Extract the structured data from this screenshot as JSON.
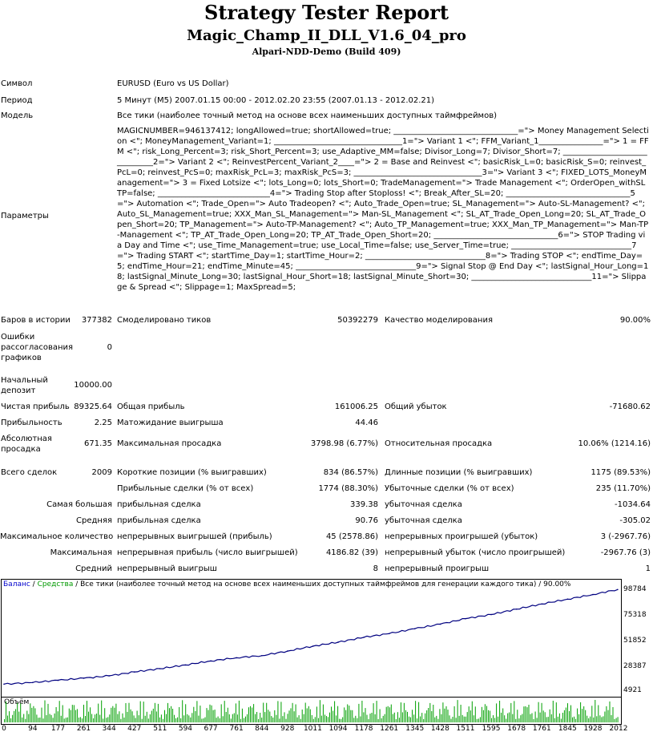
{
  "header": {
    "title": "Strategy Tester Report",
    "expert": "Magic_Champ_II_DLL_V1.6_04_pro",
    "server": "Alpari-NDD-Demo (Build 409)"
  },
  "info": {
    "symbol_label": "Символ",
    "symbol_value": "EURUSD (Euro vs US Dollar)",
    "period_label": "Период",
    "period_value": "5 Минут (M5) 2007.01.15 00:00 - 2012.02.20 23:55 (2007.01.13 - 2012.02.21)",
    "model_label": "Модель",
    "model_value": "Все тики (наиболее точный метод на основе всех наименьших доступных таймфреймов)",
    "params_label": "Параметры",
    "params_value": "MAGICNUMBER=946137412; longAllowed=true; shortAllowed=true; _______________________________=\"> Money Management Selection <\"; MoneyManagement_Variant=1; ________________________________1=\"> Variant 1 <\"; FFM_Variant_1________________=\"> 1 = FFM <\"; risk_Long_Percent=3; risk_Short_Percent=3; use_Adaptive_MM=false; Divisor_Long=7; Divisor_Short=7; ______________________________2=\"> Variant 2 <\"; ReinvestPercent_Variant_2____=\"> 2 = Base and Reinvest <\"; basicRisk_L=0; basicRisk_S=0; reinvest_PcL=0; reinvest_PcS=0; maxRisk_PcL=3; maxRisk_PcS=3; ________________________________3=\"> Variant 3 <\"; FIXED_LOTS_MoneyManagement=\"> 3 = Fixed Lotsize <\"; lots_Long=0; lots_Short=0; TradeManagement=\"> Trade Management <\"; OrderOpen_withSLTP=false; ____________________________4=\"> Trading Stop after Stoploss! <\"; Break_After_SL=20; _______________________________5=\"> Automation <\"; Trade_Open=\"> Auto Tradeopen? <\"; Auto_Trade_Open=true; SL_Management=\"> Auto-SL-Management? <\"; Auto_SL_Management=true; XXX_Man_SL_Management=\"> Man-SL_Management <\"; SL_AT_Trade_Open_Long=20; SL_AT_Trade_Open_Short=20; TP_Management=\"> Auto-TP-Management? <\"; Auto_TP_Management=true; XXX_Man_TP_Management=\"> Man-TP-Management <\"; TP_AT_Trade_Open_Long=20; TP_AT_Trade_Open_Short=20; _______________________________6=\"> STOP Trading via Day and Time <\"; use_Time_Management=true; use_Local_Time=false; use_Server_Time=true; ______________________________7=\"> Trading START <\"; startTime_Day=1; startTime_Hour=2; ______________________________8=\"> Trading STOP <\"; endTime_Day=5; endTime_Hour=21; endTime_Minute=45; ______________________________9=\"> Signal Stop @ End Day <\"; lastSignal_Hour_Long=18; lastSignal_Minute_Long=30; lastSignal_Hour_Short=18; lastSignal_Minute_Short=30; ______________________________11=\"> Slippage & Spread <\"; Slippage=1; MaxSpread=5;"
  },
  "stats": {
    "bars_label": "Баров в истории",
    "bars_value": "377382",
    "ticks_label": "Смоделировано тиков",
    "ticks_value": "50392279",
    "quality_label": "Качество моделирования",
    "quality_value": "90.00%",
    "errors_label": "Ошибки рассогласования графиков",
    "errors_value": "0",
    "deposit_label": "Начальный депозит",
    "deposit_value": "10000.00",
    "net_label": "Чистая прибыль",
    "net_value": "89325.64",
    "gross_profit_label": "Общая прибыль",
    "gross_profit_value": "161006.25",
    "gross_loss_label": "Общий убыток",
    "gross_loss_value": "-71680.62",
    "pf_label": "Прибыльность",
    "pf_value": "2.25",
    "payoff_label": "Матожидание выигрыша",
    "payoff_value": "44.46",
    "abs_dd_label": "Абсолютная просадка",
    "abs_dd_value": "671.35",
    "max_dd_label": "Максимальная просадка",
    "max_dd_value": "3798.98 (6.77%)",
    "rel_dd_label": "Относительная просадка",
    "rel_dd_value": "10.06% (1214.16)",
    "trades_label": "Всего сделок",
    "trades_value": "2009",
    "short_label": "Короткие позиции (% выигравших)",
    "short_value": "834 (86.57%)",
    "long_label": "Длинные позиции (% выигравших)",
    "long_value": "1175 (89.53%)",
    "prof_trades_label": "Прибыльные сделки (% от всех)",
    "prof_trades_value": "1774 (88.30%)",
    "loss_trades_label": "Убыточные сделки (% от всех)",
    "loss_trades_value": "235 (11.70%)",
    "largest_label": "Самая большая",
    "largest_prof_label": "прибыльная сделка",
    "largest_prof_value": "339.38",
    "largest_loss_label": "убыточная сделка",
    "largest_loss_value": "-1034.64",
    "average_label": "Средняя",
    "average_prof_label": "прибыльная сделка",
    "average_prof_value": "90.76",
    "average_loss_label": "убыточная сделка",
    "average_loss_value": "-305.02",
    "maxcount_label": "Максимальное количество",
    "maxcount_wins_label": "непрерывных выигрышей (прибыль)",
    "maxcount_wins_value": "45 (2578.86)",
    "maxcount_losses_label": "непрерывных проигрышей (убыток)",
    "maxcount_losses_value": "3 (-2967.76)",
    "max_label": "Максимальная",
    "max_profit_label": "непрерывная прибыль (число выигрышей)",
    "max_profit_value": "4186.82 (39)",
    "max_loss_label": "непрерывный убыток (число проигрышей)",
    "max_loss_value": "-2967.76 (3)",
    "avgcons_label": "Средний",
    "avgcons_wins_label": "непрерывный выигрыш",
    "avgcons_wins_value": "8",
    "avgcons_losses_label": "непрерывный проигрыш",
    "avgcons_losses_value": "1"
  },
  "chart_data": {
    "type": "line",
    "legend": {
      "balance": "Баланс",
      "sep1": " / ",
      "equity": "Средства",
      "sep2": " / ",
      "model": "Все тики (наиболее точный метод на основе всех наименьших доступных таймфреймов для генерации каждого тика)",
      "sep3": " / ",
      "quality": "90.00%"
    },
    "y_ticks": [
      "98784",
      "75318",
      "51852",
      "28387",
      "4921"
    ],
    "x_ticks": [
      "0",
      "94",
      "177",
      "261",
      "344",
      "427",
      "511",
      "594",
      "677",
      "761",
      "844",
      "928",
      "1011",
      "1094",
      "1178",
      "1261",
      "1345",
      "1428",
      "1511",
      "1595",
      "1678",
      "1761",
      "1845",
      "1928",
      "2012"
    ],
    "ylim": [
      4921,
      98784
    ],
    "xlim": [
      0,
      2012
    ],
    "series": [
      {
        "color": "#000080",
        "x": [
          0,
          94,
          177,
          261,
          344,
          427,
          511,
          594,
          677,
          761,
          844,
          928,
          1011,
          1094,
          1178,
          1261,
          1345,
          1428,
          1511,
          1595,
          1678,
          1761,
          1845,
          1928,
          2009
        ],
        "values": [
          10000,
          11500,
          13600,
          15600,
          17800,
          21500,
          24600,
          28100,
          31900,
          34900,
          36900,
          41200,
          45800,
          49600,
          54200,
          57700,
          62300,
          66600,
          71800,
          75700,
          80800,
          85700,
          90200,
          94600,
          99300
        ]
      }
    ],
    "volume_label": "Объём"
  }
}
